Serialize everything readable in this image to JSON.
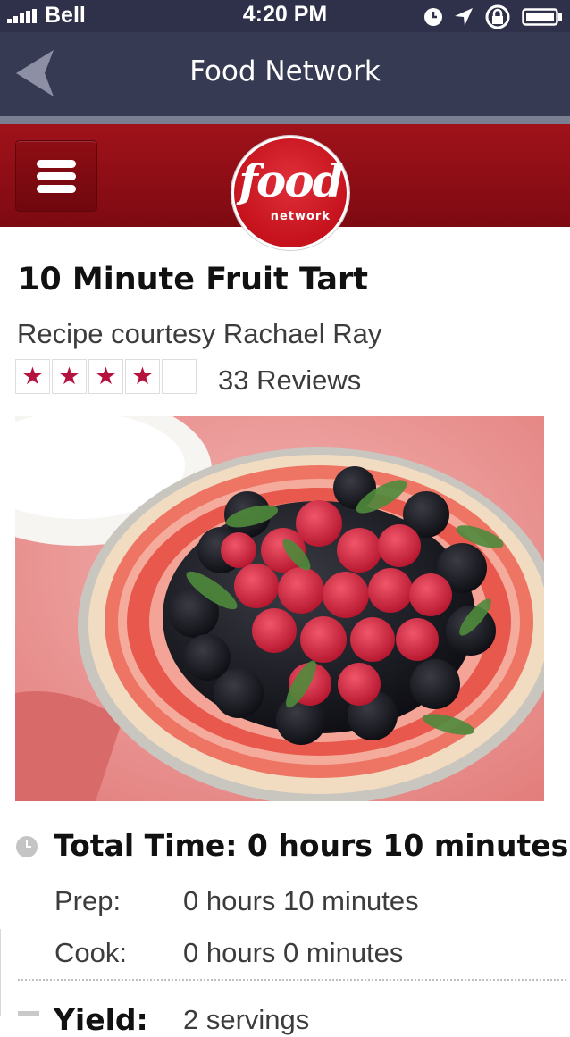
{
  "status_bar": {
    "carrier": "Bell",
    "time": "4:20 PM",
    "icons": [
      "signal-bars-icon",
      "alarm-clock-icon",
      "location-arrow-icon",
      "rotation-lock-icon",
      "battery-icon"
    ]
  },
  "nav": {
    "title": "Food Network",
    "back_icon": "back-arrow-icon"
  },
  "brand": {
    "menu_icon": "hamburger-menu-icon",
    "logo_word": "food",
    "logo_sub": "network",
    "colors": {
      "header_red": "#9a1119",
      "nav_dark": "#363a52",
      "star_color": "#b5123e"
    }
  },
  "recipe": {
    "title": "10 Minute Fruit Tart",
    "credit": "Recipe courtesy Rachael Ray",
    "rating": {
      "filled": 4,
      "max": 5,
      "reviews_label": "33 Reviews"
    },
    "photo_description_icon": "fruit-tart-photo",
    "total_time": "Total Time: 0 hours 10 minutes",
    "prep_label": "Prep:",
    "prep_value": "0 hours 10 minutes",
    "cook_label": "Cook:",
    "cook_value": "0 hours 0 minutes",
    "yield_label": "Yield:",
    "yield_value": "2 servings"
  }
}
